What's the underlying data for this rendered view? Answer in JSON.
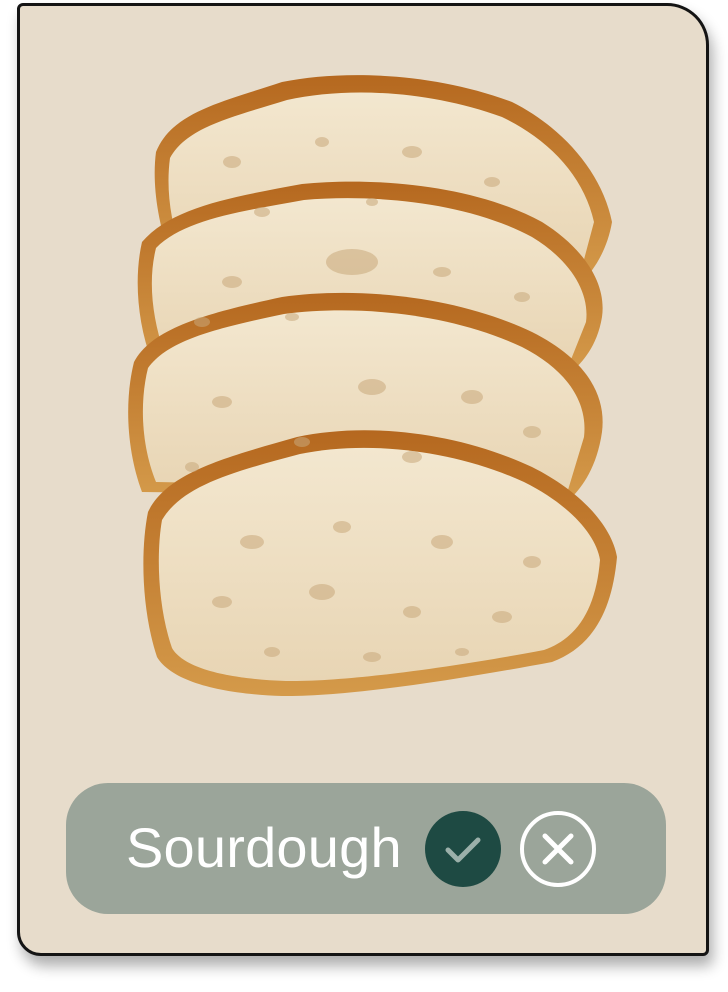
{
  "card": {
    "label": "Sourdough",
    "image_icon": "sourdough-bread-slices-image",
    "accept_icon": "check-icon",
    "reject_icon": "close-icon"
  },
  "colors": {
    "card_background": "#e7dccb",
    "pill_background": "#9ba59a",
    "accept_button": "#1e4a43",
    "text": "#ffffff"
  }
}
